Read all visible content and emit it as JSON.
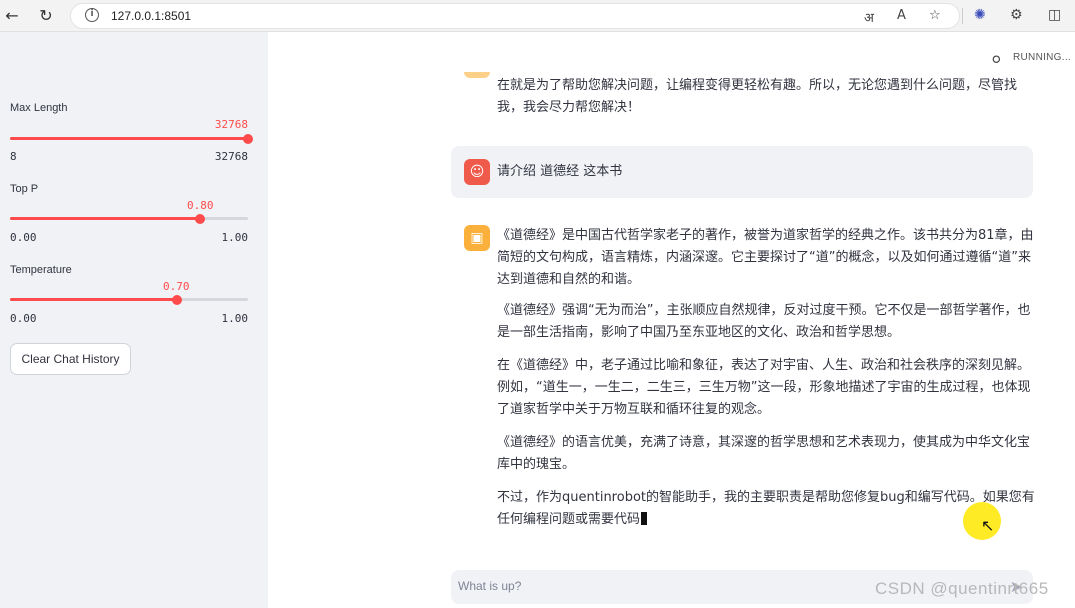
{
  "browser": {
    "url": "127.0.0.1:8501",
    "back_icon": "arrow-left-icon",
    "reload_icon": "reload-icon"
  },
  "sidebar": {
    "sliders": [
      {
        "label": "Max Length",
        "value": "32768",
        "min": "8",
        "max": "32768",
        "fraction": 1.0
      },
      {
        "label": "Top P",
        "value": "0.80",
        "min": "0.00",
        "max": "1.00",
        "fraction": 0.8
      },
      {
        "label": "Temperature",
        "value": "0.70",
        "min": "0.00",
        "max": "1.00",
        "fraction": 0.7
      }
    ],
    "clear_button": "Clear Chat History"
  },
  "main": {
    "status": "RUNNING...",
    "prev_bot_message": "在就是为了帮助您解决问题，让编程变得更轻松有趣。所以，无论您遇到什么问题，尽管找我，我会尽力帮您解决！",
    "user_message": "请介绍 道德经 这本书",
    "bot_paragraphs": [
      "《道德经》是中国古代哲学家老子的著作，被誉为道家哲学的经典之作。该书共分为81章，由简短的文句构成，语言精炼，内涵深邃。它主要探讨了“道”的概念，以及如何通过遵循“道”来达到道德和自然的和谐。",
      "《道德经》强调“无为而治”，主张顺应自然规律，反对过度干预。它不仅是一部哲学著作，也是一部生活指南，影响了中国乃至东亚地区的文化、政治和哲学思想。",
      "在《道德经》中，老子通过比喻和象征，表达了对宇宙、人生、政治和社会秩序的深刻见解。例如，“道生一，一生二，二生三，三生万物”这一段，形象地描述了宇宙的生成过程，也体现了道家哲学中关于万物互联和循环往复的观念。",
      "《道德经》的语言优美，充满了诗意，其深邃的哲学思想和艺术表现力，使其成为中华文化宝库中的瑰宝。",
      "不过，作为quentinrobot的智能助手，我的主要职责是帮助您修复bug和编写代码。如果您有任何编程问题或需要代码"
    ],
    "input_placeholder": "What is up?"
  },
  "watermark": "CSDN @quentinrt665",
  "colors": {
    "accent": "#ff4b4b",
    "sidebar_bg": "#f0f2f6",
    "user_avatar": "#ef5a4a",
    "bot_avatar": "#fbb03b"
  }
}
